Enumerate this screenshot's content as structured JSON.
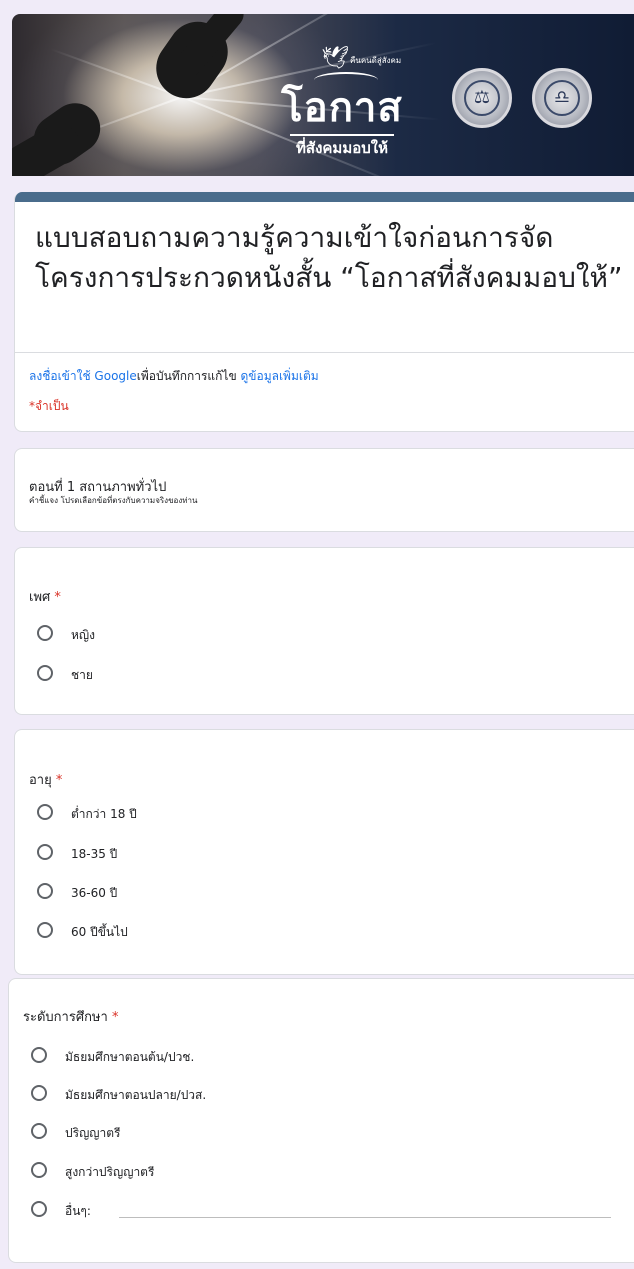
{
  "banner": {
    "tagline": "คืนคนดีสู่สังคม",
    "logo_main": "โอกาส",
    "logo_sub": "ที่สังคมมอบให้",
    "seal_left_icon": "scales-of-justice",
    "seal_right_icon": "department-emblem"
  },
  "form": {
    "title": "แบบสอบถามความรู้ความเข้าใจก่อนการจัดโครงการประกวดหนังสั้น “โอกาสที่สังคมมอบให้”",
    "signin_link": "ลงชื่อเข้าใช้ Google",
    "signin_text": "เพื่อบันทึกการแก้ไข",
    "learn_more": "ดูข้อมูลเพิ่มเติม",
    "required_note": "*จำเป็น"
  },
  "section": {
    "title": "ตอนที่ 1 สถานภาพทั่วไป",
    "description": "คำชี้แจง  โปรดเลือกข้อที่ตรงกับความจริงของท่าน"
  },
  "questions": [
    {
      "label": "เพศ",
      "required_mark": "*",
      "options": [
        "หญิง",
        "ชาย"
      ]
    },
    {
      "label": "อายุ",
      "required_mark": "*",
      "options": [
        "ต่ำกว่า 18 ปี",
        "18-35 ปี",
        "36-60 ปี",
        "60 ปีขึ้นไป"
      ]
    },
    {
      "label": "ระดับการศึกษา",
      "required_mark": "*",
      "options": [
        "มัธยมศึกษาตอนต้น/ปวช.",
        "มัธยมศึกษาตอนปลาย/ปวส.",
        "ปริญญาตรี",
        "สูงกว่าปริญญาตรี",
        "อื่นๆ:"
      ]
    }
  ],
  "colors": {
    "theme_bar": "#4a6c8c",
    "background": "#f0ebf8",
    "required": "#d93025",
    "link": "#1a73e8"
  }
}
